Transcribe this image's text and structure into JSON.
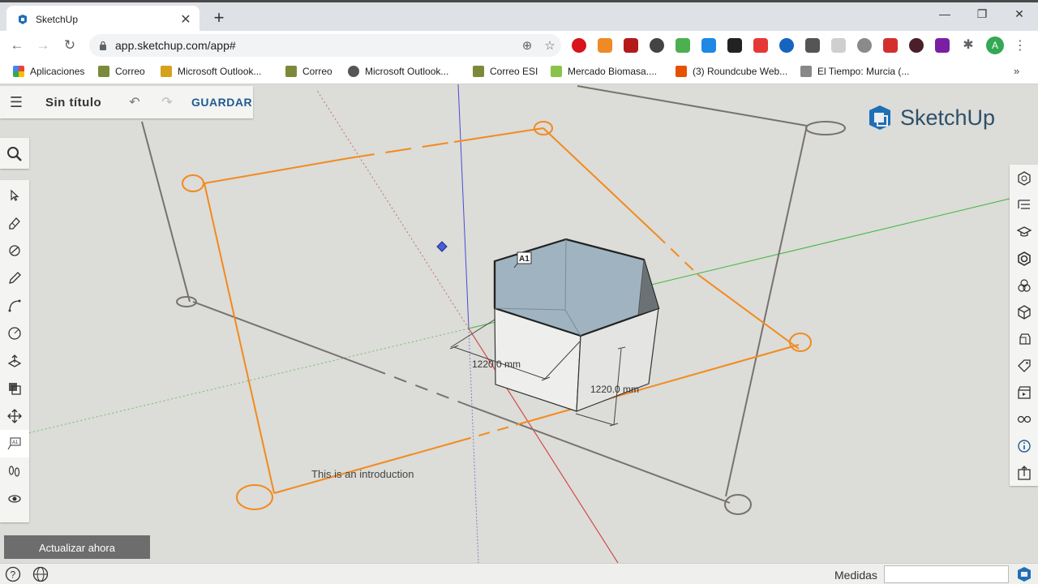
{
  "browser": {
    "tab_title": "SketchUp",
    "url": "app.sketchup.com/app#",
    "avatar_letter": "A",
    "bookmarks": [
      {
        "label": "Aplicaciones",
        "color": "#ea4335"
      },
      {
        "label": "Correo",
        "color": "#7b8a3a"
      },
      {
        "label": "Microsoft Outlook...",
        "color": "#d5a21b"
      },
      {
        "label": "Correo",
        "color": "#7b8a3a"
      },
      {
        "label": "Microsoft Outlook...",
        "color": "#555555"
      },
      {
        "label": "Correo ESI",
        "color": "#7b8a3a"
      },
      {
        "label": "Mercado Biomasa....",
        "color": "#8bc34a"
      },
      {
        "label": "(3) Roundcube Web...",
        "color": "#e65100"
      },
      {
        "label": "El Tiempo: Murcia (...",
        "color": "#888888"
      }
    ]
  },
  "app": {
    "doc_title": "Sin título",
    "save_label": "GUARDAR",
    "brand": "SketchUp",
    "update_label": "Actualizar ahora",
    "measures_label": "Medidas",
    "measures_value": ""
  },
  "scene": {
    "dim_1": "1220.0 mm",
    "dim_2": "1220.0 mm",
    "label_tag": "A1",
    "intro_text": "This is an introduction"
  },
  "colors": {
    "accent": "#1f5b93",
    "selection": "#f28a1e",
    "top_face": "#9fb4c0"
  }
}
